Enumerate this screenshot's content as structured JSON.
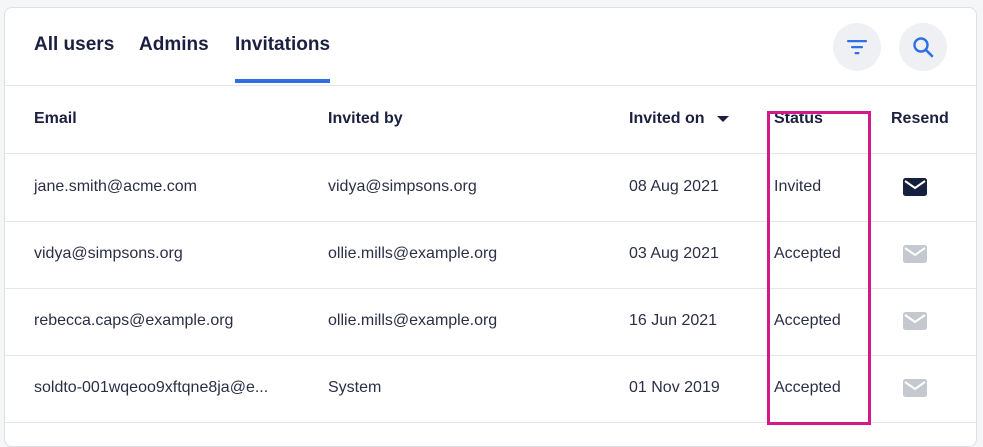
{
  "tabs": [
    {
      "label": "All users"
    },
    {
      "label": "Admins"
    },
    {
      "label": "Invitations"
    }
  ],
  "active_tab": "Invitations",
  "icons": {
    "filter": "filter-icon",
    "search": "search-icon",
    "sort": "sort-desc-caret-icon",
    "resend": "envelope-icon"
  },
  "colors": {
    "accent": "#2f6fe6",
    "highlight": "#d6198a",
    "resend_active": "#15203f",
    "resend_disabled": "#c5c9cf"
  },
  "table": {
    "headers": {
      "email": "Email",
      "invited_by": "Invited by",
      "invited_on": "Invited on",
      "status": "Status",
      "resend": "Resend"
    },
    "rows": [
      {
        "email": "jane.smith@acme.com",
        "invited_by": "vidya@simpsons.org",
        "invited_on": "08 Aug 2021",
        "status": "Invited",
        "resend_enabled": true
      },
      {
        "email": "vidya@simpsons.org",
        "invited_by": "ollie.mills@example.org",
        "invited_on": "03 Aug 2021",
        "status": "Accepted",
        "resend_enabled": false
      },
      {
        "email": "rebecca.caps@example.org",
        "invited_by": "ollie.mills@example.org",
        "invited_on": "16 Jun 2021",
        "status": "Accepted",
        "resend_enabled": false
      },
      {
        "email": "soldto-001wqeoo9xftqne8ja@e...",
        "invited_by": "System",
        "invited_on": "01 Nov 2019",
        "status": "Accepted",
        "resend_enabled": false
      }
    ]
  }
}
